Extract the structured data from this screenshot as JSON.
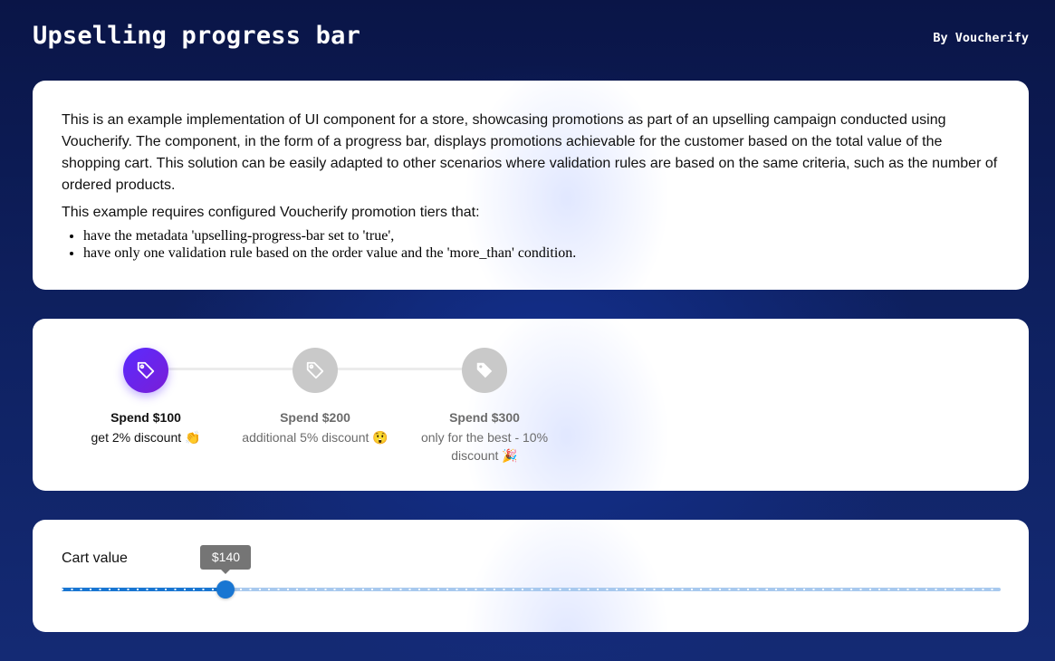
{
  "header": {
    "title": "Upselling progress bar",
    "byline": "By Voucherify"
  },
  "info": {
    "paragraph1": "This is an example implementation of UI component for a store, showcasing promotions as part of an upselling campaign conducted using Voucherify. The component, in the form of a progress bar, displays promotions achievable for the customer based on the total value of the shopping cart. This solution can be easily adapted to other scenarios where validation rules are based on the same criteria, such as the number of ordered products.",
    "paragraph2": "This example requires configured Voucherify promotion tiers that:",
    "requirements": [
      "have the metadata 'upselling-progress-bar set to 'true',",
      "have only one validation rule based on the order value and the 'more_than' condition."
    ]
  },
  "tiers": [
    {
      "title": "Spend $100",
      "description": "get 2% discount",
      "emoji": "👏",
      "icon": "tag-outline-icon",
      "achieved": true
    },
    {
      "title": "Spend $200",
      "description": "additional 5% discount",
      "emoji": "😲",
      "icon": "tag-outline-icon",
      "achieved": false
    },
    {
      "title": "Spend $300",
      "description": "only for the best - 10% discount",
      "emoji": "🎉",
      "icon": "tag-filled-icon",
      "achieved": false
    }
  ],
  "cart": {
    "label": "Cart value",
    "value_label": "$140",
    "value_fraction": 0.175
  },
  "colors": {
    "accent": "#1976d2",
    "tier_active": "#5a2bff",
    "tier_inactive": "#c9c9c9"
  }
}
